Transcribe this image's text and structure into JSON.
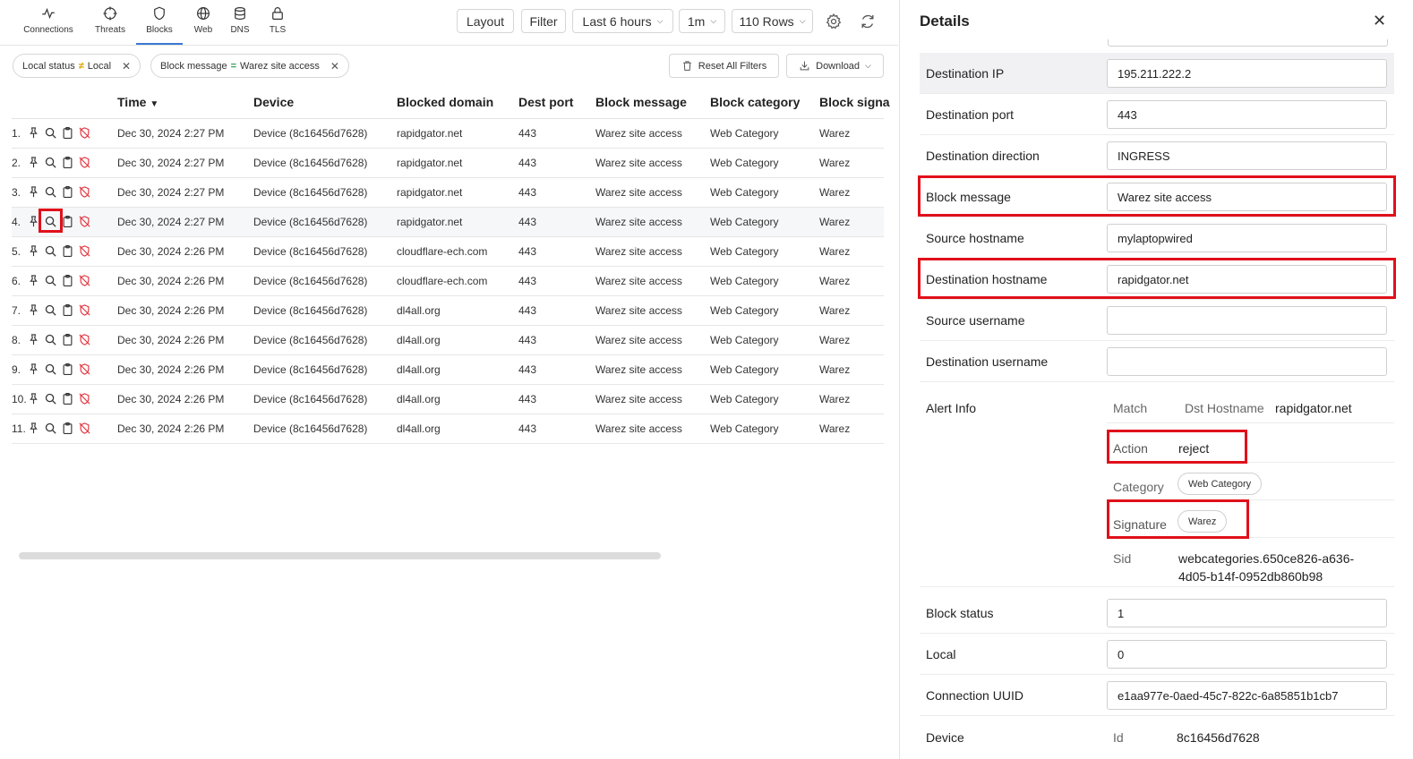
{
  "nav": {
    "tabs": [
      {
        "label": "Connections",
        "icon": "activity-icon"
      },
      {
        "label": "Threats",
        "icon": "crosshair-icon"
      },
      {
        "label": "Blocks",
        "icon": "shield-icon",
        "active": true
      },
      {
        "label": "Web",
        "icon": "globe-icon"
      },
      {
        "label": "DNS",
        "icon": "database-icon"
      },
      {
        "label": "TLS",
        "icon": "lock-icon"
      }
    ]
  },
  "toolbar": {
    "layout_label": "Layout",
    "filter_label": "Filter",
    "time_range": "Last 6 hours",
    "interval": "1m",
    "rows": "110 Rows",
    "settings_icon": "gear-icon",
    "refresh_icon": "refresh-icon"
  },
  "filters": {
    "chips": [
      {
        "key": "Local status",
        "op": "≠",
        "value": "Local"
      },
      {
        "key": "Block message",
        "op": "=",
        "value": "Warez site access"
      }
    ],
    "reset_label": "Reset All Filters",
    "download_label": "Download"
  },
  "table": {
    "columns": [
      "Time",
      "Device",
      "Blocked domain",
      "Dest port",
      "Block message",
      "Block category",
      "Block signa"
    ],
    "rows": [
      {
        "n": "1.",
        "time": "Dec 30, 2024 2:27 PM",
        "device": "Device (8c16456d7628)",
        "domain": "rapidgator.net",
        "port": "443",
        "message": "Warez site access",
        "category": "Web Category",
        "signature": "Warez"
      },
      {
        "n": "2.",
        "time": "Dec 30, 2024 2:27 PM",
        "device": "Device (8c16456d7628)",
        "domain": "rapidgator.net",
        "port": "443",
        "message": "Warez site access",
        "category": "Web Category",
        "signature": "Warez"
      },
      {
        "n": "3.",
        "time": "Dec 30, 2024 2:27 PM",
        "device": "Device (8c16456d7628)",
        "domain": "rapidgator.net",
        "port": "443",
        "message": "Warez site access",
        "category": "Web Category",
        "signature": "Warez"
      },
      {
        "n": "4.",
        "time": "Dec 30, 2024 2:27 PM",
        "device": "Device (8c16456d7628)",
        "domain": "rapidgator.net",
        "port": "443",
        "message": "Warez site access",
        "category": "Web Category",
        "signature": "Warez"
      },
      {
        "n": "5.",
        "time": "Dec 30, 2024 2:26 PM",
        "device": "Device (8c16456d7628)",
        "domain": "cloudflare-ech.com",
        "port": "443",
        "message": "Warez site access",
        "category": "Web Category",
        "signature": "Warez"
      },
      {
        "n": "6.",
        "time": "Dec 30, 2024 2:26 PM",
        "device": "Device (8c16456d7628)",
        "domain": "cloudflare-ech.com",
        "port": "443",
        "message": "Warez site access",
        "category": "Web Category",
        "signature": "Warez"
      },
      {
        "n": "7.",
        "time": "Dec 30, 2024 2:26 PM",
        "device": "Device (8c16456d7628)",
        "domain": "dl4all.org",
        "port": "443",
        "message": "Warez site access",
        "category": "Web Category",
        "signature": "Warez"
      },
      {
        "n": "8.",
        "time": "Dec 30, 2024 2:26 PM",
        "device": "Device (8c16456d7628)",
        "domain": "dl4all.org",
        "port": "443",
        "message": "Warez site access",
        "category": "Web Category",
        "signature": "Warez"
      },
      {
        "n": "9.",
        "time": "Dec 30, 2024 2:26 PM",
        "device": "Device (8c16456d7628)",
        "domain": "dl4all.org",
        "port": "443",
        "message": "Warez site access",
        "category": "Web Category",
        "signature": "Warez"
      },
      {
        "n": "10.",
        "time": "Dec 30, 2024 2:26 PM",
        "device": "Device (8c16456d7628)",
        "domain": "dl4all.org",
        "port": "443",
        "message": "Warez site access",
        "category": "Web Category",
        "signature": "Warez"
      },
      {
        "n": "11.",
        "time": "Dec 30, 2024 2:26 PM",
        "device": "Device (8c16456d7628)",
        "domain": "dl4all.org",
        "port": "443",
        "message": "Warez site access",
        "category": "Web Category",
        "signature": "Warez"
      }
    ],
    "row_icons": [
      "pin-icon",
      "search-icon",
      "clipboard-icon",
      "shield-off-icon"
    ]
  },
  "details": {
    "title": "Details",
    "close_icon": "close-icon",
    "fields": [
      {
        "label": "Destination IP",
        "value": "195.211.222.2"
      },
      {
        "label": "Destination port",
        "value": "443"
      },
      {
        "label": "Destination direction",
        "value": "INGRESS"
      },
      {
        "label": "Block message",
        "value": "Warez site access"
      },
      {
        "label": "Source hostname",
        "value": "mylaptopwired"
      },
      {
        "label": "Destination hostname",
        "value": "rapidgator.net"
      },
      {
        "label": "Source username",
        "value": ""
      },
      {
        "label": "Destination username",
        "value": ""
      }
    ],
    "alert_info": {
      "label": "Alert Info",
      "match_key": "Match",
      "match_subkey": "Dst Hostname",
      "match_value": "rapidgator.net",
      "action_key": "Action",
      "action_value": "reject",
      "category_key": "Category",
      "category_value": "Web Category",
      "signature_key": "Signature",
      "signature_value": "Warez",
      "sid_key": "Sid",
      "sid_value_line1": "webcategories.650ce826-a636-",
      "sid_value_line2": "4d05-b14f-0952db860b98"
    },
    "fields2": [
      {
        "label": "Block status",
        "value": "1"
      },
      {
        "label": "Local",
        "value": "0"
      },
      {
        "label": "Connection UUID",
        "value": "e1aa977e-0aed-45c7-822c-6a85851b1cb7"
      }
    ],
    "device": {
      "label": "Device",
      "id_key": "Id",
      "id_value": "8c16456d7628"
    }
  }
}
